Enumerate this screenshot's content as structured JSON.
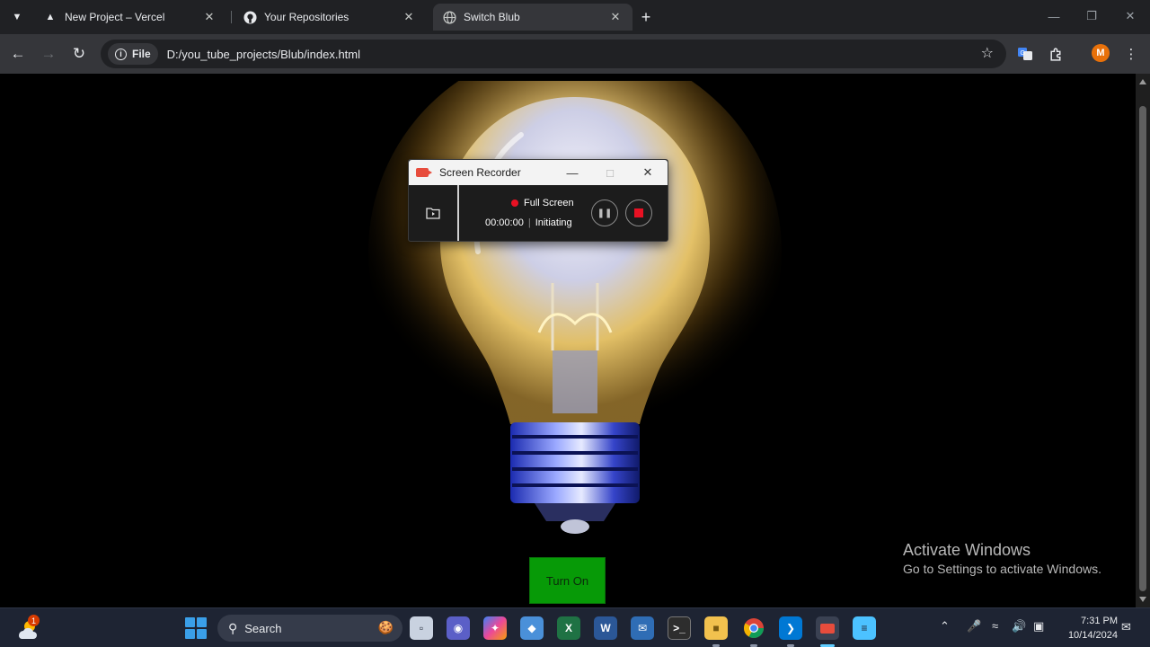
{
  "browser": {
    "tabs": [
      {
        "title": "New Project – Vercel",
        "icon": "vercel-icon",
        "active": false
      },
      {
        "title": "Your Repositories",
        "icon": "github-icon",
        "active": false
      },
      {
        "title": "Switch Blub",
        "icon": "globe-icon",
        "active": true
      }
    ],
    "address": {
      "chip_label": "File",
      "url": "D:/you_tube_projects/Blub/index.html"
    },
    "profile_initial": "M"
  },
  "page": {
    "button_label": "Turn On",
    "button_color": "#079a07"
  },
  "recorder": {
    "title": "Screen Recorder",
    "mode": "Full Screen",
    "elapsed": "00:00:00",
    "status": "Initiating"
  },
  "watermark": {
    "line1": "Activate Windows",
    "line2": "Go to Settings to activate Windows."
  },
  "taskbar": {
    "weather_badge": "1",
    "search_label": "Search",
    "clock_time": "7:31 PM",
    "clock_date": "10/14/2024"
  },
  "colors": {
    "accent": "#60cdff",
    "recording": "#e81123",
    "avatar": "#e8710a"
  }
}
